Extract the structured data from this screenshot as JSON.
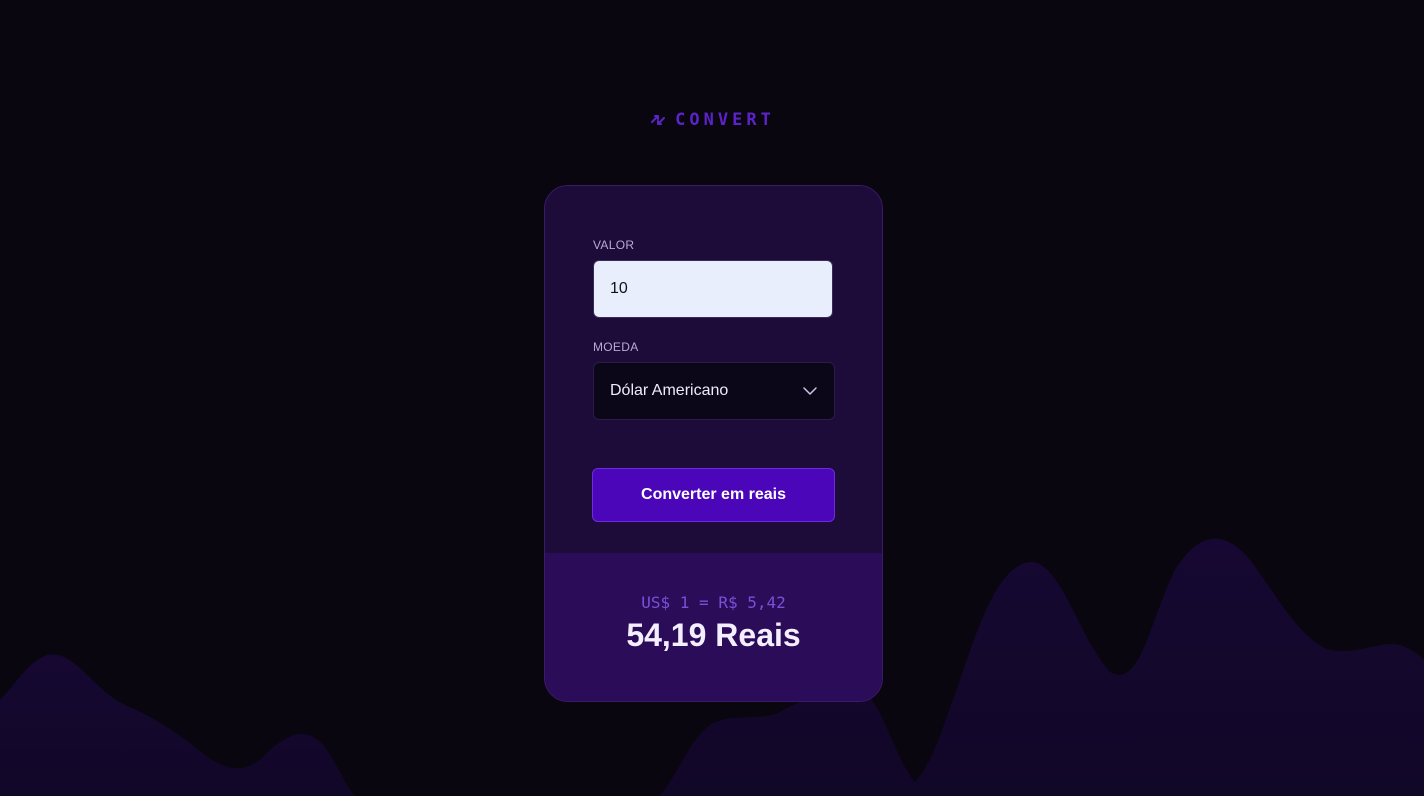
{
  "app": {
    "logo_text": "CONVERT",
    "logo_icon": "swap-arrows-icon",
    "accent_color": "#5b23c9"
  },
  "form": {
    "valor_label": "VALOR",
    "valor_value": "10",
    "moeda_label": "MOEDA",
    "moeda_selected": "Dólar Americano",
    "convert_button_label": "Converter em reais"
  },
  "result": {
    "rate_text": "US$ 1 = R$ 5,42",
    "converted_value": "54,19 Reais"
  },
  "colors": {
    "background": "#09060f",
    "card": "#1d0b3a",
    "result_panel": "#2a0c58",
    "button": "#4a06b8",
    "wave": "#12072a"
  }
}
